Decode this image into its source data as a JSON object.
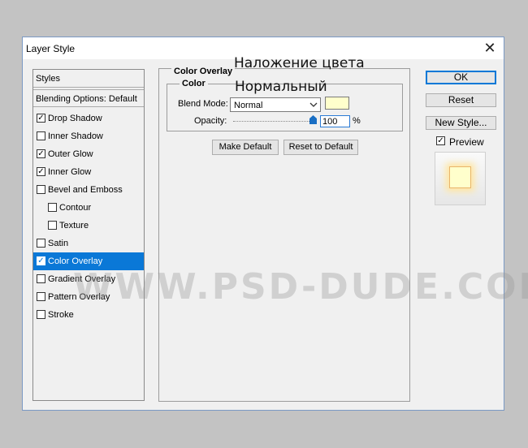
{
  "window": {
    "title": "Layer Style",
    "close_glyph": "✕"
  },
  "styles_list": {
    "header": "Styles",
    "blending": "Blending Options: Default",
    "items": [
      {
        "label": "Drop Shadow",
        "checked": true,
        "indent": false,
        "selected": false
      },
      {
        "label": "Inner Shadow",
        "checked": false,
        "indent": false,
        "selected": false
      },
      {
        "label": "Outer Glow",
        "checked": true,
        "indent": false,
        "selected": false
      },
      {
        "label": "Inner Glow",
        "checked": true,
        "indent": false,
        "selected": false
      },
      {
        "label": "Bevel and Emboss",
        "checked": false,
        "indent": false,
        "selected": false
      },
      {
        "label": "Contour",
        "checked": false,
        "indent": true,
        "selected": false
      },
      {
        "label": "Texture",
        "checked": false,
        "indent": true,
        "selected": false
      },
      {
        "label": "Satin",
        "checked": false,
        "indent": false,
        "selected": false
      },
      {
        "label": "Color Overlay",
        "checked": true,
        "indent": false,
        "selected": true
      },
      {
        "label": "Gradient Overlay",
        "checked": false,
        "indent": false,
        "selected": false
      },
      {
        "label": "Pattern Overlay",
        "checked": false,
        "indent": false,
        "selected": false
      },
      {
        "label": "Stroke",
        "checked": false,
        "indent": false,
        "selected": false
      }
    ]
  },
  "panel": {
    "title": "Color Overlay",
    "group_title": "Color",
    "blend_mode_label": "Blend Mode:",
    "blend_mode_value": "Normal",
    "overlay_color": "#ffffcc",
    "opacity_label": "Opacity:",
    "opacity_value": "100",
    "opacity_unit": "%",
    "make_default": "Make Default",
    "reset_default": "Reset to Default"
  },
  "right": {
    "ok": "OK",
    "reset": "Reset",
    "new_style": "New Style...",
    "preview_label": "Preview",
    "preview_checked": true
  },
  "annotations": {
    "russian_title": "Наложение цвета",
    "russian_mode": "Нормальный"
  },
  "watermark": "WWW.PSD-DUDE.COM",
  "colors": {
    "accent": "#0a78d7",
    "selection": "#0a78d7"
  }
}
